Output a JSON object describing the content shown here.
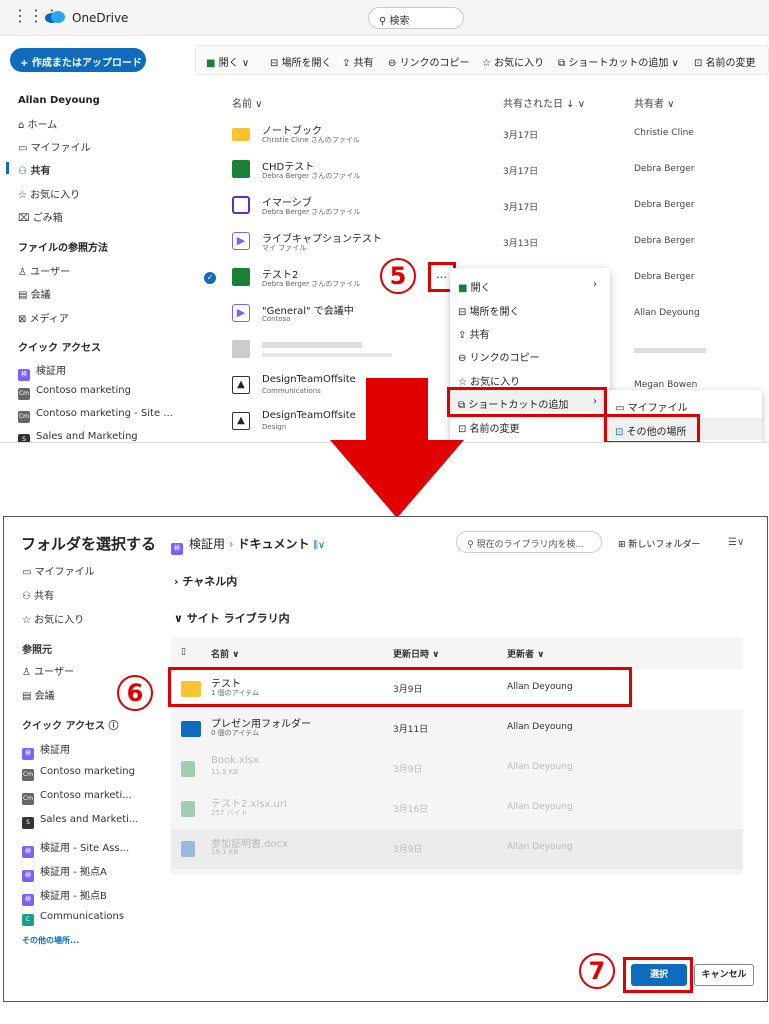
{
  "top": {
    "app_name": "OneDrive",
    "search_placeholder": "検索",
    "upload_button": "+ 作成またはアップロード",
    "commands": [
      "開く ∨",
      "場所を開く",
      "共有",
      "リンクのコピー",
      "お気に入り",
      "ショートカットの追加 ∨",
      "名前の変更"
    ],
    "user_name": "Allan Deyoung",
    "nav_main": [
      "ホーム",
      "マイファイル",
      "共有",
      "お気に入り",
      "ごみ箱"
    ],
    "browse_heading": "ファイルの参照方法",
    "browse_items": [
      "ユーザー",
      "会議",
      "メディア"
    ],
    "quick_heading": "クイック アクセス",
    "quick_items": [
      "検証用",
      "Contoso marketing",
      "Contoso marketing - Site ...",
      "Sales and Marketing"
    ],
    "columns": {
      "name": "名前 ∨",
      "shared": "共有された日 ↓ ∨",
      "sharer": "共有者 ∨"
    },
    "rows": [
      {
        "name": "ノートブック",
        "sub": "Christie Cline さんのファイル",
        "date": "3月17日",
        "owner": "Christie Cline"
      },
      {
        "name": "CHDテスト",
        "sub": "Debra Berger さんのファイル",
        "date": "3月17日",
        "owner": "Debra Berger"
      },
      {
        "name": "イマーシブ",
        "sub": "Debra Berger さんのファイル",
        "date": "3月17日",
        "owner": "Debra Berger"
      },
      {
        "name": "ライブキャプションテスト",
        "sub": "マイ ファイル",
        "date": "3月13日",
        "owner": "Debra Berger"
      },
      {
        "name": "テスト2",
        "sub": "Debra Berger さんのファイル",
        "date": "",
        "owner": "Debra Berger"
      },
      {
        "name": "\"General\" で会議中",
        "sub": "Contoso",
        "date": "",
        "owner": "Allan Deyoung"
      },
      {
        "name": "",
        "sub": "",
        "date": "",
        "owner": ""
      },
      {
        "name": "DesignTeamOffsite",
        "sub": "Communications",
        "date": "",
        "owner": "Megan Bowen"
      },
      {
        "name": "DesignTeamOffsite",
        "sub": "Design",
        "date": "",
        "owner": ""
      }
    ],
    "context_menu": [
      "開く",
      "場所を開く",
      "共有",
      "リンクのコピー",
      "お気に入り",
      "ショートカットの追加",
      "名前の変更"
    ],
    "submenu": [
      "マイファイル",
      "その他の場所"
    ],
    "step5": "5",
    "more_button": "…"
  },
  "bottom": {
    "title": "フォルダを選択する",
    "nav": [
      "マイファイル",
      "共有",
      "お気に入り"
    ],
    "ref_heading": "参照元",
    "ref_items": [
      "ユーザー",
      "会議"
    ],
    "quick_heading": "クイック アクセス ⓘ",
    "quick_items": [
      "検証用",
      "Contoso marketing",
      "Contoso marketi...",
      "Sales and Marketi...",
      "検証用 - Site Ass...",
      "検証用 - 拠点A",
      "検証用 - 拠点B",
      "Communications"
    ],
    "more_places": "その他の場所...",
    "crumb_site": "検証用",
    "crumb_sep": "›",
    "crumb_lib": "ドキュメント",
    "search_placeholder": "現在のライブラリ内を検...",
    "new_folder": "新しいフォルダー",
    "channels": "› チャネル内",
    "site_libs": "∨ サイト ライブラリ内",
    "columns": {
      "name": "名前 ∨",
      "modified": "更新日時 ∨",
      "modifier": "更新者 ∨"
    },
    "rows": [
      {
        "name": "テスト",
        "sub": "1 個のアイテム",
        "date": "3月9日",
        "user": "Allan Deyoung"
      },
      {
        "name": "プレゼン用フォルダー",
        "sub": "0 個のアイテム",
        "date": "3月11日",
        "user": "Allan Deyoung"
      },
      {
        "name": "Book.xlsx",
        "sub": "11.5 KB",
        "date": "3月9日",
        "user": "Allan Deyoung"
      },
      {
        "name": "テスト2.xlsx.url",
        "sub": "257 バイト",
        "date": "3月16日",
        "user": "Allan Deyoung"
      },
      {
        "name": "参加証明書.docx",
        "sub": "19.1 KB",
        "date": "3月9日",
        "user": "Allan Deyoung"
      }
    ],
    "select_button": "選択",
    "cancel_button": "キャンセル",
    "step6": "6",
    "step7": "7"
  },
  "colors": {
    "accent": "#0f6cbd",
    "highlight": "#e00000",
    "folder": "#f8c230"
  }
}
